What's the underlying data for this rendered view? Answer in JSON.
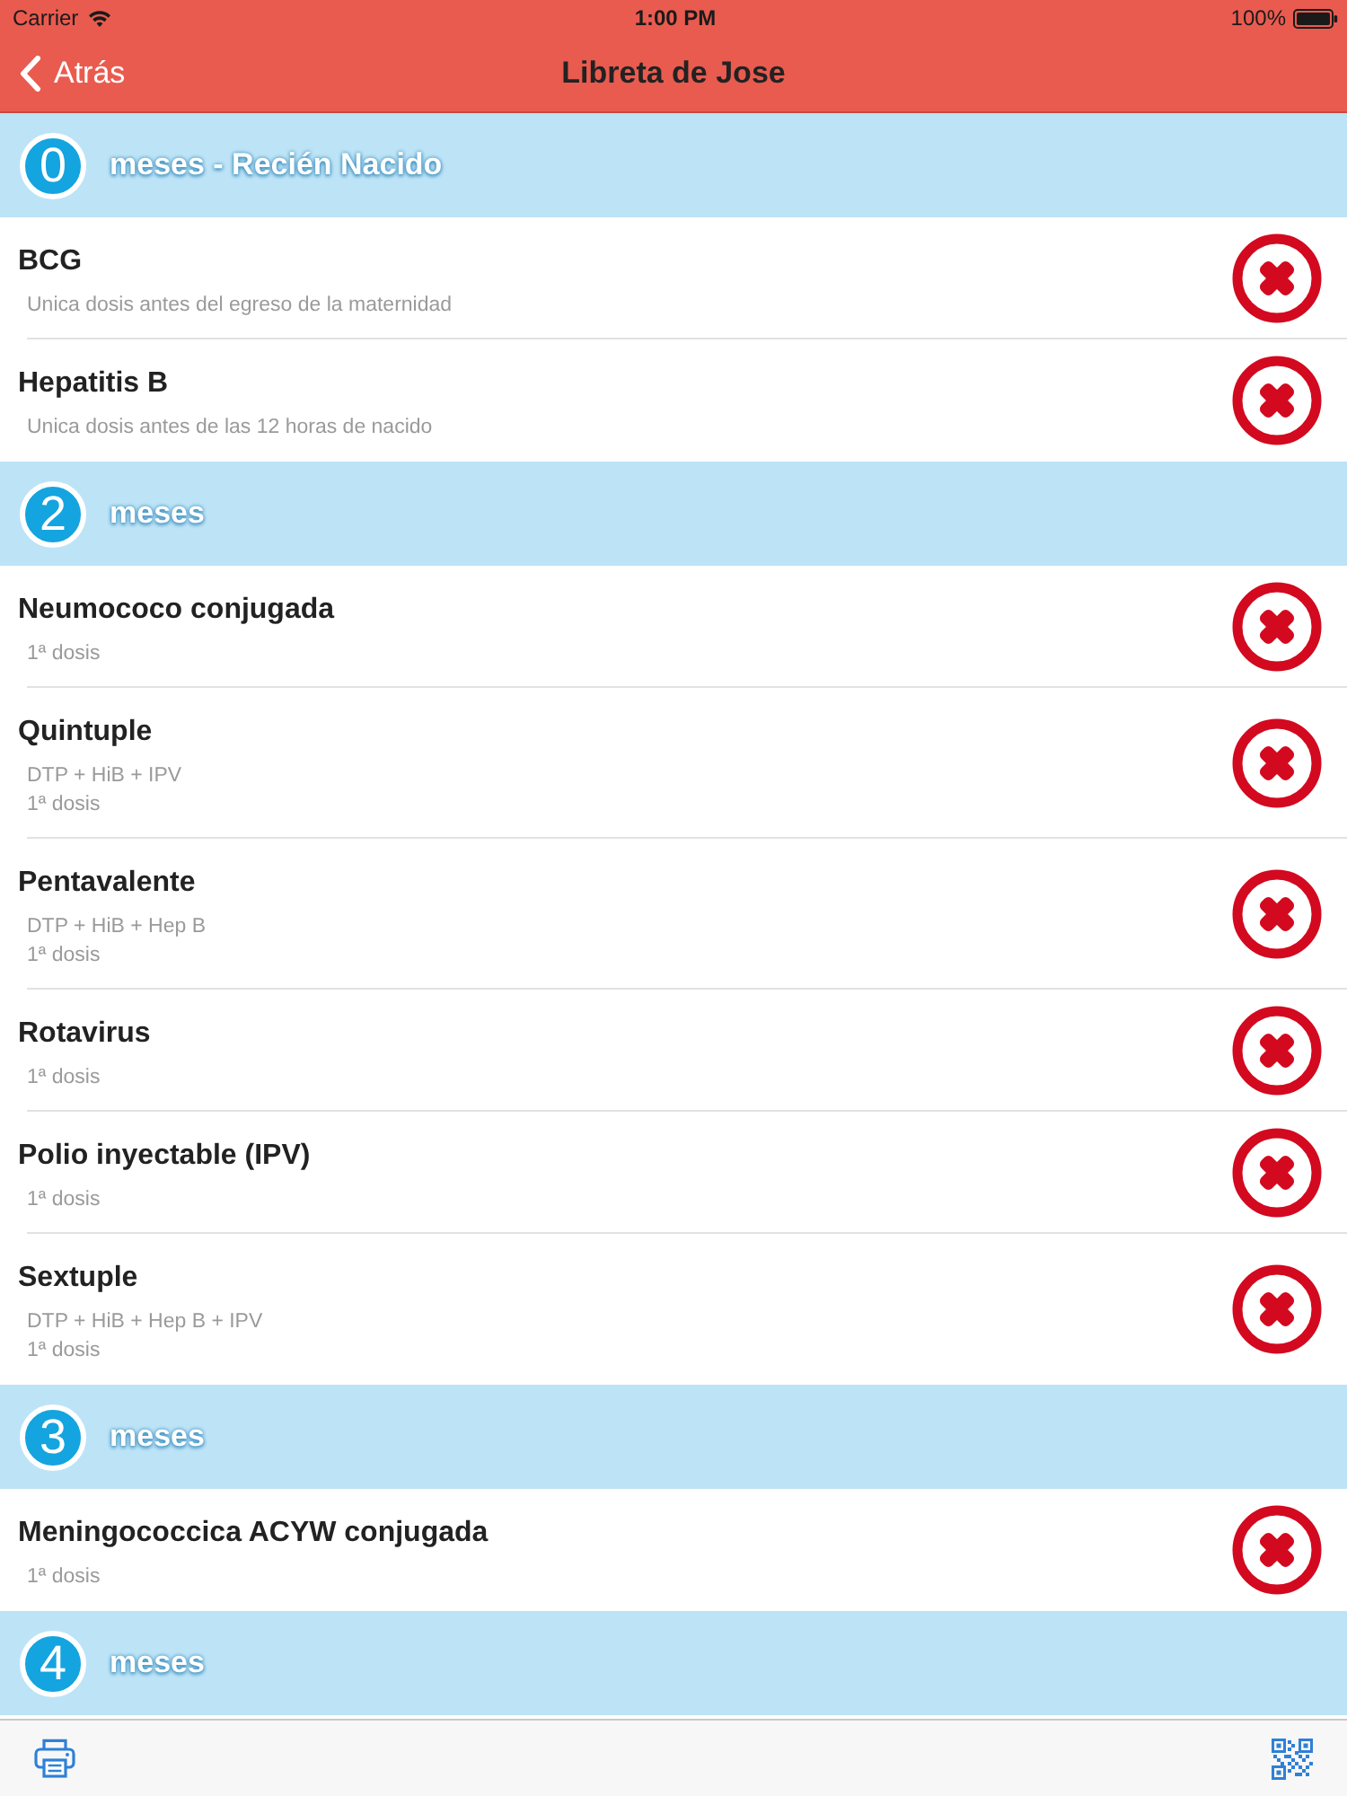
{
  "status_bar": {
    "carrier": "Carrier",
    "time": "1:00 PM",
    "battery": "100%"
  },
  "nav_bar": {
    "back": "Atrás",
    "title": "Libreta de Jose"
  },
  "sections": [
    {
      "number": "0",
      "label": "meses - Recién Nacido",
      "vaccines": [
        {
          "name": "BCG",
          "details": [
            "Unica dosis antes del egreso de la maternidad"
          ],
          "applied": false
        },
        {
          "name": "Hepatitis B",
          "details": [
            "Unica dosis antes de las 12 horas de nacido"
          ],
          "applied": false
        }
      ]
    },
    {
      "number": "2",
      "label": "meses",
      "vaccines": [
        {
          "name": "Neumococo conjugada",
          "details": [
            "1ª dosis"
          ],
          "applied": false
        },
        {
          "name": "Quintuple",
          "details": [
            "DTP + HiB + IPV",
            "1ª dosis"
          ],
          "applied": false
        },
        {
          "name": "Pentavalente",
          "details": [
            "DTP + HiB + Hep B",
            "1ª dosis"
          ],
          "applied": false
        },
        {
          "name": "Rotavirus",
          "details": [
            "1ª dosis"
          ],
          "applied": false
        },
        {
          "name": "Polio inyectable (IPV)",
          "details": [
            "1ª dosis"
          ],
          "applied": false
        },
        {
          "name": "Sextuple",
          "details": [
            "DTP + HiB + Hep B + IPV",
            "1ª dosis"
          ],
          "applied": false
        }
      ]
    },
    {
      "number": "3",
      "label": "meses",
      "vaccines": [
        {
          "name": "Meningococcica ACYW conjugada",
          "details": [
            "1ª dosis"
          ],
          "applied": false
        }
      ]
    },
    {
      "number": "4",
      "label": "meses"
    }
  ]
}
